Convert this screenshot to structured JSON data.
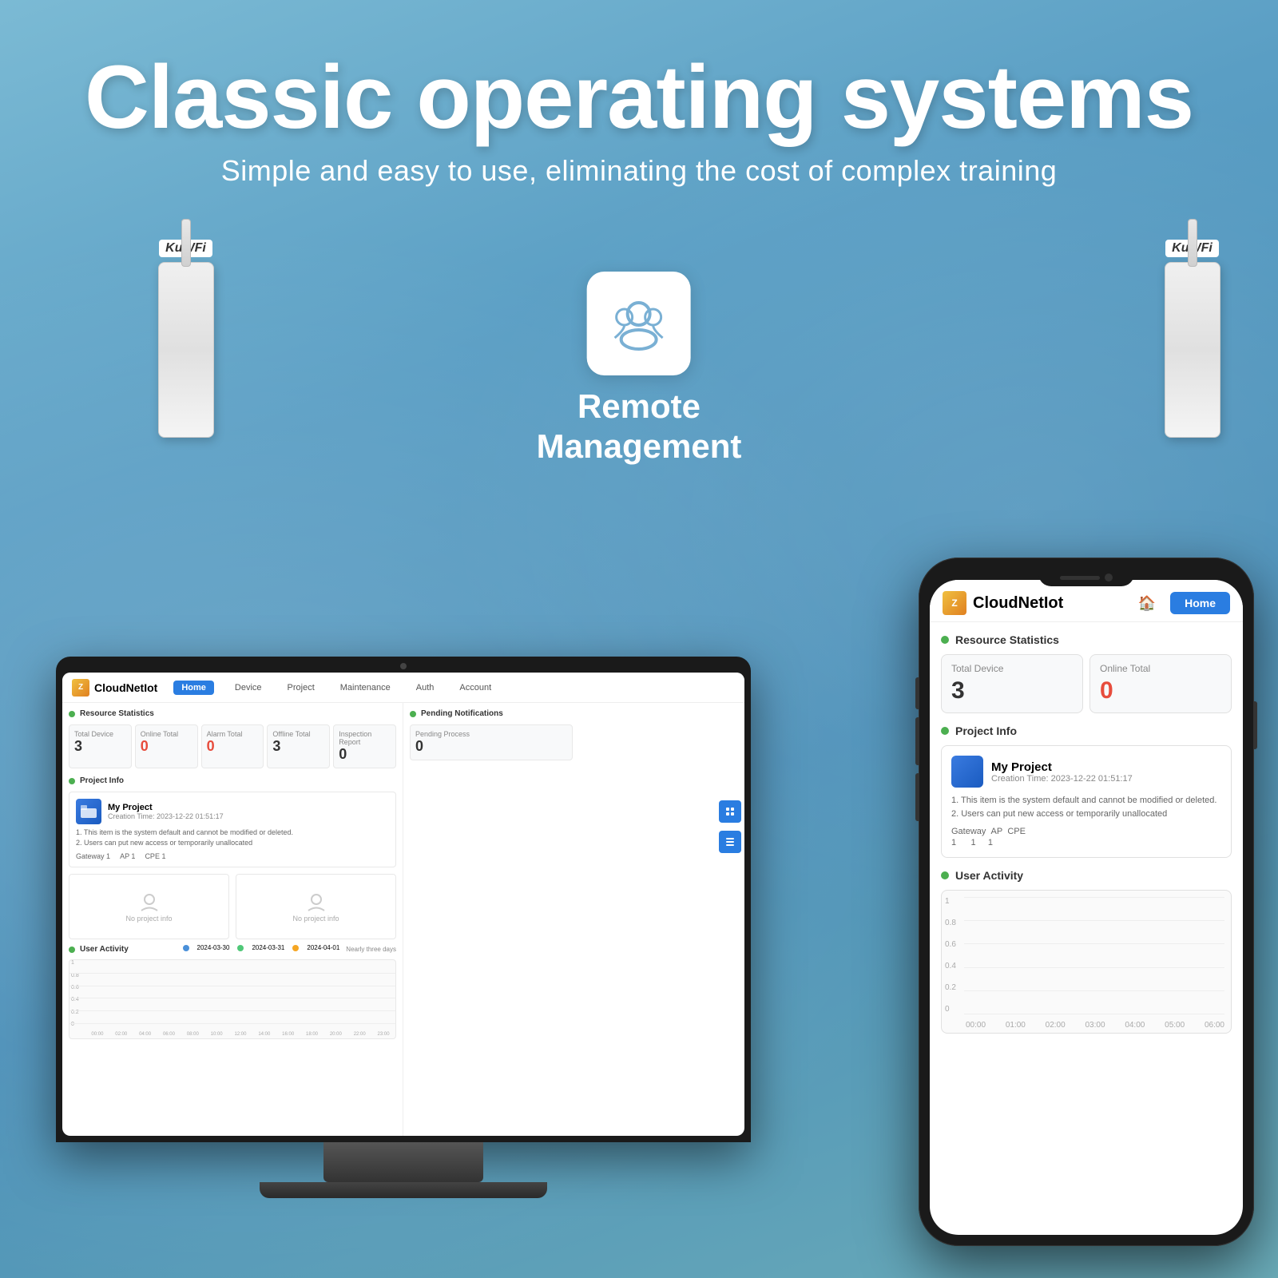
{
  "page": {
    "main_title": "Classic operating systems",
    "sub_title": "Simple and easy to use, eliminating the cost of complex training"
  },
  "remote": {
    "label_line1": "Remote",
    "label_line2": "Management"
  },
  "desktop_app": {
    "logo": "CloudNetIot",
    "nav": {
      "home": "Home",
      "device": "Device",
      "project": "Project",
      "maintenance": "Maintenance",
      "auth": "Auth",
      "account": "Account"
    },
    "resource_statistics": {
      "title": "Resource Statistics",
      "total_device_label": "Total Device",
      "total_device_value": "3",
      "online_total_label": "Online Total",
      "online_total_value": "0",
      "alarm_total_label": "Alarm Total",
      "alarm_total_value": "0",
      "offline_total_label": "Offline Total",
      "offline_total_value": "3",
      "inspection_report_label": "Inspection Report",
      "inspection_report_value": "0"
    },
    "project_info": {
      "title": "Project Info",
      "my_project_name": "My Project",
      "creation_time": "Creation Time: 2023-12-22 01:51:17",
      "desc1": "1. This item is the system default and cannot be modified or deleted.",
      "desc2": "2. Users can put new access or temporarily unallocated",
      "gateway_label": "Gateway",
      "gateway_value": "1",
      "ap_label": "AP",
      "ap_value": "1",
      "cpe_label": "CPE",
      "cpe_value": "1",
      "no_project_info": "No project info"
    },
    "pending": {
      "title": "Pending Notifications",
      "pending_process_label": "Pending Process",
      "pending_process_value": "0"
    },
    "user_activity": {
      "title": "User Activity",
      "time_range": "Nearly three days",
      "legend1": "2024-03-30",
      "legend2": "2024-03-31",
      "legend3": "2024-04-01",
      "y_labels": [
        "1",
        "0.8",
        "0.6",
        "0.4",
        "0.2",
        "0"
      ]
    }
  },
  "phone_app": {
    "logo": "CloudNetIot",
    "home_btn": "Home",
    "resource_statistics": {
      "title": "Resource Statistics",
      "total_device_label": "Total Device",
      "total_device_value": "3",
      "online_total_label": "Online Total",
      "online_total_value": "0"
    },
    "project_info": {
      "title": "Project Info",
      "my_project_name": "My Project",
      "creation_time": "Creation Time: 2023-12-22 01:51:17",
      "desc1": "1. This item is the system default and cannot be modified or deleted.",
      "desc2": "2. Users can put new access or temporarily unallocated",
      "gateway_label": "Gateway",
      "gateway_value": "1",
      "ap_label": "AP",
      "ap_value": "1",
      "cpe_label": "CPE",
      "cpe_value": "1"
    },
    "user_activity": {
      "title": "User Activity",
      "y_labels": [
        "1",
        "0.8",
        "0.6",
        "0.4",
        "0.2",
        "0"
      ],
      "x_labels": [
        "00:00",
        "01:00",
        "02:00",
        "03:00",
        "04:00",
        "05:00",
        "06:00"
      ]
    }
  }
}
